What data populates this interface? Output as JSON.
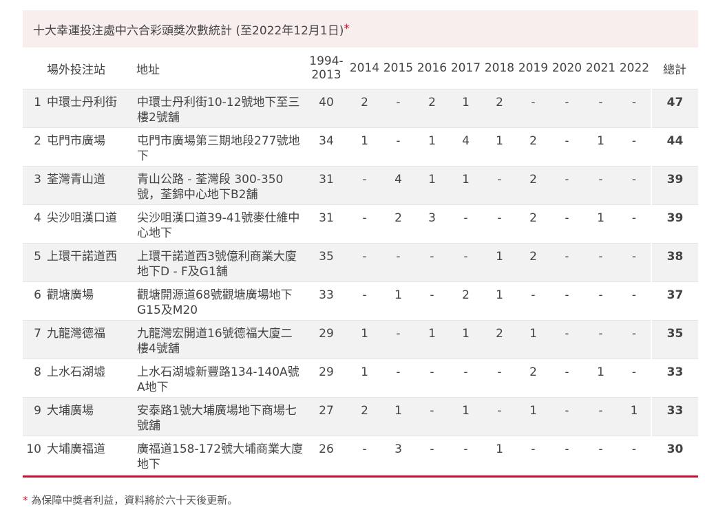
{
  "title": "十大幸運投注處中六合彩頭獎次數統計 (至2022年12月1日)",
  "title_asterisk": "*",
  "headers": {
    "station": "場外投注站",
    "address": "地址",
    "range": "1994-2013",
    "y2014": "2014",
    "y2015": "2015",
    "y2016": "2016",
    "y2017": "2017",
    "y2018": "2018",
    "y2019": "2019",
    "y2020": "2020",
    "y2021": "2021",
    "y2022": "2022",
    "total": "總計"
  },
  "rows": [
    {
      "rank": "1",
      "station": "中環士丹利街",
      "address": "中環士丹利街10-12號地下至三樓2號舖",
      "range": "40",
      "y2014": "2",
      "y2015": "-",
      "y2016": "2",
      "y2017": "1",
      "y2018": "2",
      "y2019": "-",
      "y2020": "-",
      "y2021": "-",
      "y2022": "-",
      "total": "47"
    },
    {
      "rank": "2",
      "station": "屯門市廣場",
      "address": "屯門市廣場第三期地段277號地下",
      "range": "34",
      "y2014": "1",
      "y2015": "-",
      "y2016": "1",
      "y2017": "4",
      "y2018": "1",
      "y2019": "2",
      "y2020": "-",
      "y2021": "1",
      "y2022": "-",
      "total": "44"
    },
    {
      "rank": "3",
      "station": "荃灣青山道",
      "address": "青山公路 - 荃灣段 300-350號，荃錦中心地下B2舖",
      "range": "31",
      "y2014": "-",
      "y2015": "4",
      "y2016": "1",
      "y2017": "1",
      "y2018": "-",
      "y2019": "2",
      "y2020": "-",
      "y2021": "-",
      "y2022": "-",
      "total": "39"
    },
    {
      "rank": "4",
      "station": "尖沙咀漢口道",
      "address": "尖沙咀漢口道39-41號麥仕維中心地下",
      "range": "31",
      "y2014": "-",
      "y2015": "2",
      "y2016": "3",
      "y2017": "-",
      "y2018": "-",
      "y2019": "2",
      "y2020": "-",
      "y2021": "1",
      "y2022": "-",
      "total": "39"
    },
    {
      "rank": "5",
      "station": "上環干諾道西",
      "address": "上環干諾道西3號億利商業大廈地下D - F及G1舖",
      "range": "35",
      "y2014": "-",
      "y2015": "-",
      "y2016": "-",
      "y2017": "-",
      "y2018": "1",
      "y2019": "2",
      "y2020": "-",
      "y2021": "-",
      "y2022": "-",
      "total": "38"
    },
    {
      "rank": "6",
      "station": "觀塘廣場",
      "address": "觀塘開源道68號觀塘廣場地下G15及M20",
      "range": "33",
      "y2014": "-",
      "y2015": "1",
      "y2016": "-",
      "y2017": "2",
      "y2018": "1",
      "y2019": "-",
      "y2020": "-",
      "y2021": "-",
      "y2022": "-",
      "total": "37"
    },
    {
      "rank": "7",
      "station": "九龍灣德福",
      "address": "九龍灣宏開道16號德福大廈二樓4號舖",
      "range": "29",
      "y2014": "1",
      "y2015": "-",
      "y2016": "1",
      "y2017": "1",
      "y2018": "2",
      "y2019": "1",
      "y2020": "-",
      "y2021": "-",
      "y2022": "-",
      "total": "35"
    },
    {
      "rank": "8",
      "station": "上水石湖墟",
      "address": "上水石湖墟新豐路134-140A號A地下",
      "range": "29",
      "y2014": "1",
      "y2015": "-",
      "y2016": "-",
      "y2017": "-",
      "y2018": "-",
      "y2019": "2",
      "y2020": "-",
      "y2021": "1",
      "y2022": "-",
      "total": "33"
    },
    {
      "rank": "9",
      "station": "大埔廣場",
      "address": "安泰路1號大埔廣場地下商場七號舖",
      "range": "27",
      "y2014": "2",
      "y2015": "1",
      "y2016": "-",
      "y2017": "1",
      "y2018": "-",
      "y2019": "1",
      "y2020": "-",
      "y2021": "-",
      "y2022": "1",
      "total": "33"
    },
    {
      "rank": "10",
      "station": "大埔廣福道",
      "address": "廣福道158-172號大埔商業大廈地下",
      "range": "26",
      "y2014": "-",
      "y2015": "3",
      "y2016": "-",
      "y2017": "-",
      "y2018": "1",
      "y2019": "-",
      "y2020": "-",
      "y2021": "-",
      "y2022": "-",
      "total": "30"
    }
  ],
  "footnote_asterisk": "*",
  "footnote": " 為保障中獎者利益，資料將於六十天後更新。",
  "colors": {
    "accent": "#c8102e",
    "title_bg": "#f9eeee",
    "row_alt_bg": "#f2f2f2"
  }
}
